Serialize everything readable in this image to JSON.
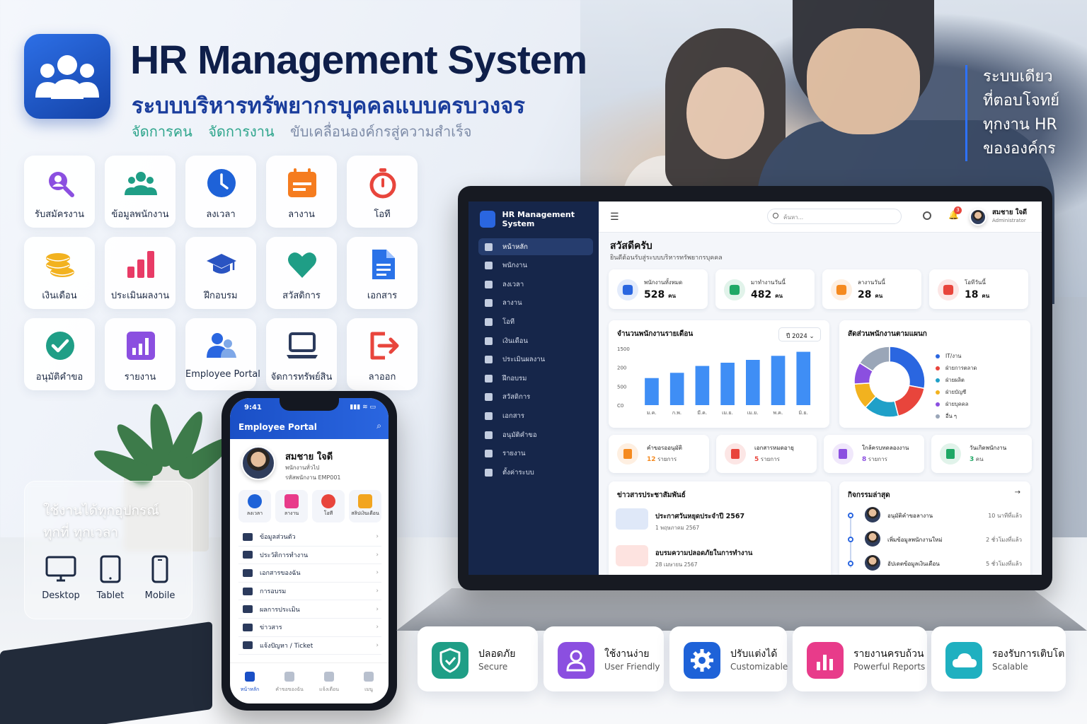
{
  "header": {
    "title": "HR Management System",
    "subtitle": "ระบบบริหารทรัพยากรบุคคลแบบครบวงจร",
    "tagline": [
      "จัดการคน",
      "จัดการงาน",
      "ขับเคลื่อนองค์กรสู่ความสำเร็จ"
    ]
  },
  "side_text": [
    "ระบบเดียว",
    "ที่ตอบโจทย์",
    "ทุกงาน HR",
    "ขององค์กร"
  ],
  "modules": [
    {
      "label": "รับสมัครงาน",
      "icon": "recruit-search-icon",
      "color": "#8b4fe0"
    },
    {
      "label": "ข้อมูลพนักงาน",
      "icon": "employees-icon",
      "color": "#1f9e86"
    },
    {
      "label": "ลงเวลา",
      "icon": "clock-icon",
      "color": "#1e62d8"
    },
    {
      "label": "ลางาน",
      "icon": "calendar-icon",
      "color": "#f57c1f"
    },
    {
      "label": "โอที",
      "icon": "stopwatch-icon",
      "color": "#e8453c"
    },
    {
      "label": "เงินเดือน",
      "icon": "coins-icon",
      "color": "#f2b21f"
    },
    {
      "label": "ประเมินผลงาน",
      "icon": "bar-chart-icon",
      "color": "#e83b66"
    },
    {
      "label": "ฝึกอบรม",
      "icon": "graduation-cap-icon",
      "color": "#2a54c2"
    },
    {
      "label": "สวัสดิการ",
      "icon": "heart-icon",
      "color": "#1f9e86"
    },
    {
      "label": "เอกสาร",
      "icon": "document-icon",
      "color": "#2a72e8"
    },
    {
      "label": "อนุมัติคำขอ",
      "icon": "check-circle-icon",
      "color": "#1f9e86"
    },
    {
      "label": "รายงาน",
      "icon": "report-chart-icon",
      "color": "#8b4fe0"
    },
    {
      "label": "Employee Portal",
      "icon": "portal-users-icon",
      "color": "#2a66e0"
    },
    {
      "label": "จัดการทรัพย์สิน",
      "icon": "laptop-icon",
      "color": "#2b3a5c"
    },
    {
      "label": "ลาออก",
      "icon": "exit-icon",
      "color": "#e8453c"
    }
  ],
  "devices": {
    "title_lines": [
      "ใช้งานได้ทุกอุปกรณ์",
      "ทุกที่ ทุกเวลา"
    ],
    "items": [
      {
        "label": "Desktop",
        "icon": "desktop-icon"
      },
      {
        "label": "Tablet",
        "icon": "tablet-icon"
      },
      {
        "label": "Mobile",
        "icon": "mobile-icon"
      }
    ]
  },
  "phone": {
    "time": "9:41",
    "title": "Employee Portal",
    "user_name": "สมชาย ใจดี",
    "user_role": "พนักงานทั่วไป",
    "user_id": "รหัสพนักงาน EMP001",
    "quick": [
      {
        "label": "ลงเวลา",
        "color": "#1e62d8"
      },
      {
        "label": "ลางาน",
        "color": "#e83b8a"
      },
      {
        "label": "โอที",
        "color": "#e8453c"
      },
      {
        "label": "สลิปเงินเดือน",
        "color": "#f2a51f"
      }
    ],
    "menu": [
      "ข้อมูลส่วนตัว",
      "ประวัติการทำงาน",
      "เอกสารของฉัน",
      "การอบรม",
      "ผลการประเมิน",
      "ข่าวสาร",
      "แจ้งปัญหา / Ticket"
    ],
    "nav": [
      "หน้าหลัก",
      "คำขอของฉัน",
      "แจ้งเตือน",
      "เมนู"
    ]
  },
  "dashboard": {
    "brand": "HR Management System",
    "sidebar": [
      "หน้าหลัก",
      "พนักงาน",
      "ลงเวลา",
      "ลางาน",
      "โอที",
      "เงินเดือน",
      "ประเมินผลงาน",
      "ฝึกอบรม",
      "สวัสดิการ",
      "เอกสาร",
      "อนุมัติคำขอ",
      "รายงาน",
      "ตั้งค่าระบบ"
    ],
    "search_placeholder": "ค้นหา...",
    "notification_count": "3",
    "user_name": "สมชาย ใจดี",
    "user_role": "Administrator",
    "greeting": "สวัสดีครับ",
    "greeting_sub": "ยินดีต้อนรับสู่ระบบบริหารทรัพยากรบุคคล",
    "stats": [
      {
        "label": "พนักงานทั้งหมด",
        "value": "528",
        "unit": "คน",
        "color": "#2a66e0"
      },
      {
        "label": "มาทำงานวันนี้",
        "value": "482",
        "unit": "คน",
        "color": "#1fa865"
      },
      {
        "label": "ลางานวันนี้",
        "value": "28",
        "unit": "คน",
        "color": "#f58a1f"
      },
      {
        "label": "โอทีวันนี้",
        "value": "18",
        "unit": "คน",
        "color": "#e8453c"
      }
    ],
    "bar_title": "จำนวนพนักงานรายเดือน",
    "year_select": "ปี 2024",
    "donut_title": "สัดส่วนพนักงานตามแผนก",
    "pending": [
      {
        "label": "คำขอรออนุมัติ",
        "count": "12",
        "unit": "รายการ",
        "color": "#f58a1f"
      },
      {
        "label": "เอกสารหมดอายุ",
        "count": "5",
        "unit": "รายการ",
        "color": "#e8453c"
      },
      {
        "label": "ใกล้ครบทดลองงาน",
        "count": "8",
        "unit": "รายการ",
        "color": "#8b4fe0"
      },
      {
        "label": "วันเกิดพนักงาน",
        "count": "3",
        "unit": "คน",
        "color": "#1fa865"
      }
    ],
    "news_title": "ข่าวสารประชาสัมพันธ์",
    "news": [
      {
        "title": "ประกาศวันหยุดประจำปี 2567",
        "date": "1 พฤษภาคม 2567",
        "color": "#dfe8f8"
      },
      {
        "title": "อบรมความปลอดภัยในการทำงาน",
        "date": "28 เมษายน 2567",
        "color": "#fde3e0"
      }
    ],
    "activity_title": "กิจกรรมล่าสุด",
    "activity_more": "→",
    "activities": [
      {
        "action": "อนุมัติคำขอลางาน",
        "time": "10 นาทีที่แล้ว"
      },
      {
        "action": "เพิ่มข้อมูลพนักงานใหม่",
        "time": "2 ชั่วโมงที่แล้ว"
      },
      {
        "action": "อัปเดตข้อมูลเงินเดือน",
        "time": "5 ชั่วโมงที่แล้ว"
      }
    ]
  },
  "chart_data": [
    {
      "type": "bar",
      "title": "จำนวนพนักงานรายเดือน",
      "categories": [
        "ม.ค.",
        "ก.พ.",
        "มี.ค.",
        "เม.ย.",
        "เม.ย.",
        "พ.ค.",
        "มิ.ย."
      ],
      "values": [
        335,
        400,
        485,
        525,
        560,
        610,
        660
      ],
      "y_ticks": [
        "1500",
        "200",
        "500",
        "C0"
      ],
      "color": "#3f8ef5"
    },
    {
      "type": "pie",
      "title": "สัดส่วนพนักงานตามแผนก",
      "labels": [
        "IT/งาน",
        "ฝ่ายการตลาด",
        "ฝ่ายผลิต",
        "ฝ่ายบัญชี",
        "ฝ่ายบุคคล",
        "อื่น ๆ"
      ],
      "values": [
        28,
        18,
        16,
        12,
        10,
        16
      ],
      "display": [
        "28%",
        "18%",
        "16%",
        "12%",
        "10%",
        "16%"
      ],
      "colors": [
        "#2a66e0",
        "#e8453c",
        "#1fa0c8",
        "#f2b21f",
        "#8b4fe0",
        "#9aa6b8"
      ]
    }
  ],
  "features": [
    {
      "title": "ปลอดภัย",
      "sub": "Secure",
      "icon": "shield-check-icon",
      "color": "#1f9e86"
    },
    {
      "title": "ใช้งานง่าย",
      "sub": "User Friendly",
      "icon": "user-icon",
      "color": "#8b4fe0"
    },
    {
      "title": "ปรับแต่งได้",
      "sub": "Customizable",
      "icon": "gear-icon",
      "color": "#1e62d8"
    },
    {
      "title": "รายงานครบถ้วน",
      "sub": "Powerful Reports",
      "icon": "bar-chart-icon",
      "color": "#e83b8a"
    },
    {
      "title": "รองรับการเติบโต",
      "sub": "Scalable",
      "icon": "cloud-icon",
      "color": "#1fb0c0"
    }
  ]
}
